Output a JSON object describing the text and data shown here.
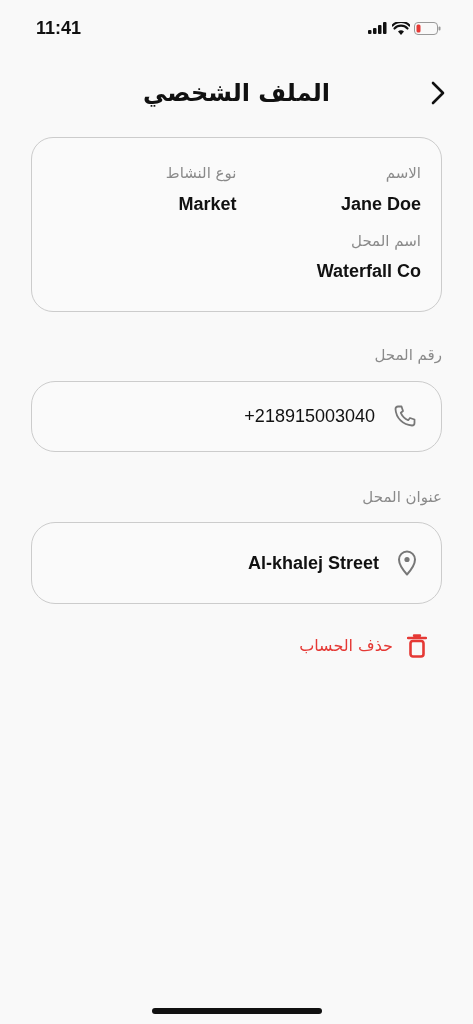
{
  "status_bar": {
    "time": "11:41"
  },
  "header": {
    "title": "الملف الشخصي"
  },
  "info_card": {
    "fields": [
      {
        "label": "الاسم",
        "value": "Jane Doe"
      },
      {
        "label": "نوع النشاط",
        "value": "Market"
      },
      {
        "label": "اسم المحل",
        "value": "Waterfall Co"
      }
    ]
  },
  "contact_fields": [
    {
      "kind": "phone",
      "label": "رقم المحل",
      "value": "+218915003040"
    },
    {
      "kind": "address",
      "label": "عنوان المحل",
      "value": "Al-khalej Street"
    }
  ],
  "delete_account": {
    "label": "حذف الحساب"
  }
}
